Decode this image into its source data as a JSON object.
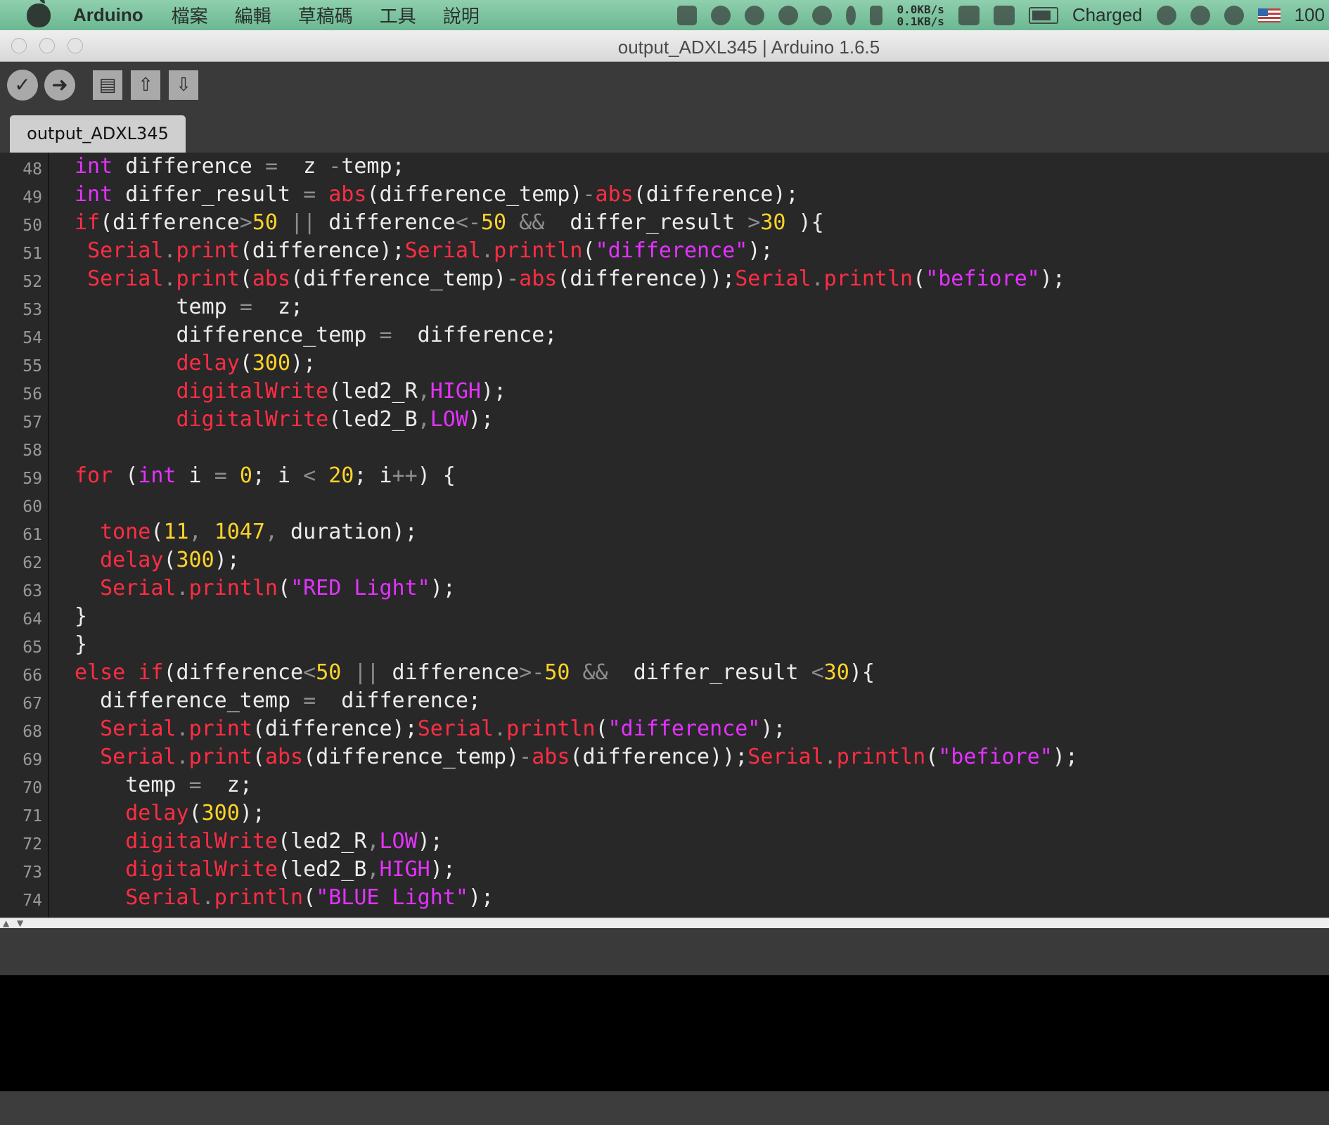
{
  "menubar": {
    "app_name": "Arduino",
    "menus": [
      "檔案",
      "編輯",
      "草稿碼",
      "工具",
      "說明"
    ],
    "net_up": "0.0KB/s",
    "net_down": "0.1KB/s",
    "battery_status": "Charged",
    "battery_percent": "100",
    "icons": [
      "apple-icon",
      "ji-icon",
      "line-icon",
      "creative-cloud-icon",
      "hat-icon",
      "check-shield-icon",
      "bluetooth-icon",
      "network-monitor-icon",
      "memory-icon",
      "disk-icon",
      "battery-icon",
      "time-machine-icon",
      "wifi-icon",
      "volume-icon",
      "flag-icon"
    ]
  },
  "window": {
    "title": "output_ADXL345 | Arduino 1.6.5"
  },
  "toolbar": {
    "buttons": [
      "verify",
      "upload",
      "new",
      "open",
      "save"
    ],
    "glyphs": [
      "✓",
      "➜",
      "▤",
      "⇧",
      "⇩"
    ]
  },
  "tabs": [
    {
      "label": "output_ADXL345"
    }
  ],
  "editor": {
    "line_numbers": [
      "48",
      "49",
      "50",
      "51",
      "52",
      "53",
      "54",
      "55",
      "56",
      "57",
      "58",
      "59",
      "60",
      "61",
      "62",
      "63",
      "64",
      "65",
      "66",
      "67",
      "68",
      "69",
      "70",
      "71",
      "72",
      "73",
      "74"
    ],
    "lines": [
      [
        [
          "k",
          "int"
        ],
        [
          "t",
          " difference "
        ],
        [
          "o",
          "="
        ],
        [
          "t",
          "  z "
        ],
        [
          "o",
          "-"
        ],
        [
          "t",
          "temp;"
        ]
      ],
      [
        [
          "k",
          "int"
        ],
        [
          "t",
          " differ_result "
        ],
        [
          "o",
          "="
        ],
        [
          "t",
          " "
        ],
        [
          "f",
          "abs"
        ],
        [
          "t",
          "(difference_temp)"
        ],
        [
          "o",
          "-"
        ],
        [
          "f",
          "abs"
        ],
        [
          "t",
          "(difference);"
        ]
      ],
      [
        [
          "f",
          "if"
        ],
        [
          "t",
          "(difference"
        ],
        [
          "o",
          ">"
        ],
        [
          "n",
          "50"
        ],
        [
          "t",
          " "
        ],
        [
          "o",
          "||"
        ],
        [
          "t",
          " difference"
        ],
        [
          "o",
          "<-"
        ],
        [
          "n",
          "50"
        ],
        [
          "t",
          " "
        ],
        [
          "o",
          "&&"
        ],
        [
          "t",
          "  differ_result "
        ],
        [
          "o",
          ">"
        ],
        [
          "n",
          "30"
        ],
        [
          "t",
          " ){"
        ]
      ],
      [
        [
          "t",
          " "
        ],
        [
          "f",
          "Serial"
        ],
        [
          "o",
          "."
        ],
        [
          "f",
          "print"
        ],
        [
          "t",
          "(difference);"
        ],
        [
          "f",
          "Serial"
        ],
        [
          "o",
          "."
        ],
        [
          "f",
          "println"
        ],
        [
          "t",
          "("
        ],
        [
          "s",
          "\"difference\""
        ],
        [
          "t",
          ");"
        ]
      ],
      [
        [
          "t",
          " "
        ],
        [
          "f",
          "Serial"
        ],
        [
          "o",
          "."
        ],
        [
          "f",
          "print"
        ],
        [
          "t",
          "("
        ],
        [
          "f",
          "abs"
        ],
        [
          "t",
          "(difference_temp)"
        ],
        [
          "o",
          "-"
        ],
        [
          "f",
          "abs"
        ],
        [
          "t",
          "(difference));"
        ],
        [
          "f",
          "Serial"
        ],
        [
          "o",
          "."
        ],
        [
          "f",
          "println"
        ],
        [
          "t",
          "("
        ],
        [
          "s",
          "\"befiore\""
        ],
        [
          "t",
          ");"
        ]
      ],
      [
        [
          "t",
          "        temp "
        ],
        [
          "o",
          "="
        ],
        [
          "t",
          "  z;"
        ]
      ],
      [
        [
          "t",
          "        difference_temp "
        ],
        [
          "o",
          "="
        ],
        [
          "t",
          "  difference;"
        ]
      ],
      [
        [
          "t",
          "        "
        ],
        [
          "f",
          "delay"
        ],
        [
          "t",
          "("
        ],
        [
          "n",
          "300"
        ],
        [
          "t",
          ");"
        ]
      ],
      [
        [
          "t",
          "        "
        ],
        [
          "f",
          "digitalWrite"
        ],
        [
          "t",
          "(led2_R"
        ],
        [
          "o",
          ","
        ],
        [
          "k",
          "HIGH"
        ],
        [
          "t",
          ");"
        ]
      ],
      [
        [
          "t",
          "        "
        ],
        [
          "f",
          "digitalWrite"
        ],
        [
          "t",
          "(led2_B"
        ],
        [
          "o",
          ","
        ],
        [
          "k",
          "LOW"
        ],
        [
          "t",
          ");"
        ]
      ],
      [],
      [
        [
          "f",
          "for"
        ],
        [
          "t",
          " ("
        ],
        [
          "k",
          "int"
        ],
        [
          "t",
          " i "
        ],
        [
          "o",
          "="
        ],
        [
          "t",
          " "
        ],
        [
          "n",
          "0"
        ],
        [
          "t",
          "; i "
        ],
        [
          "o",
          "<"
        ],
        [
          "t",
          " "
        ],
        [
          "n",
          "20"
        ],
        [
          "t",
          "; i"
        ],
        [
          "o",
          "++"
        ],
        [
          "t",
          ") {"
        ]
      ],
      [],
      [
        [
          "t",
          "  "
        ],
        [
          "f",
          "tone"
        ],
        [
          "t",
          "("
        ],
        [
          "n",
          "11"
        ],
        [
          "o",
          ","
        ],
        [
          "t",
          " "
        ],
        [
          "n",
          "1047"
        ],
        [
          "o",
          ","
        ],
        [
          "t",
          " duration);"
        ]
      ],
      [
        [
          "t",
          "  "
        ],
        [
          "f",
          "delay"
        ],
        [
          "t",
          "("
        ],
        [
          "n",
          "300"
        ],
        [
          "t",
          ");"
        ]
      ],
      [
        [
          "t",
          "  "
        ],
        [
          "f",
          "Serial"
        ],
        [
          "o",
          "."
        ],
        [
          "f",
          "println"
        ],
        [
          "t",
          "("
        ],
        [
          "s",
          "\"RED Light\""
        ],
        [
          "t",
          ");"
        ]
      ],
      [
        [
          "t",
          "}"
        ]
      ],
      [
        [
          "t",
          "}"
        ]
      ],
      [
        [
          "f",
          "else"
        ],
        [
          "t",
          " "
        ],
        [
          "f",
          "if"
        ],
        [
          "t",
          "(difference"
        ],
        [
          "o",
          "<"
        ],
        [
          "n",
          "50"
        ],
        [
          "t",
          " "
        ],
        [
          "o",
          "||"
        ],
        [
          "t",
          " difference"
        ],
        [
          "o",
          ">-"
        ],
        [
          "n",
          "50"
        ],
        [
          "t",
          " "
        ],
        [
          "o",
          "&&"
        ],
        [
          "t",
          "  differ_result "
        ],
        [
          "o",
          "<"
        ],
        [
          "n",
          "30"
        ],
        [
          "t",
          "){"
        ]
      ],
      [
        [
          "t",
          "  difference_temp "
        ],
        [
          "o",
          "="
        ],
        [
          "t",
          "  difference;"
        ]
      ],
      [
        [
          "t",
          "  "
        ],
        [
          "f",
          "Serial"
        ],
        [
          "o",
          "."
        ],
        [
          "f",
          "print"
        ],
        [
          "t",
          "(difference);"
        ],
        [
          "f",
          "Serial"
        ],
        [
          "o",
          "."
        ],
        [
          "f",
          "println"
        ],
        [
          "t",
          "("
        ],
        [
          "s",
          "\"difference\""
        ],
        [
          "t",
          ");"
        ]
      ],
      [
        [
          "t",
          "  "
        ],
        [
          "f",
          "Serial"
        ],
        [
          "o",
          "."
        ],
        [
          "f",
          "print"
        ],
        [
          "t",
          "("
        ],
        [
          "f",
          "abs"
        ],
        [
          "t",
          "(difference_temp)"
        ],
        [
          "o",
          "-"
        ],
        [
          "f",
          "abs"
        ],
        [
          "t",
          "(difference));"
        ],
        [
          "f",
          "Serial"
        ],
        [
          "o",
          "."
        ],
        [
          "f",
          "println"
        ],
        [
          "t",
          "("
        ],
        [
          "s",
          "\"befiore\""
        ],
        [
          "t",
          ");"
        ]
      ],
      [
        [
          "t",
          "    temp "
        ],
        [
          "o",
          "="
        ],
        [
          "t",
          "  z;"
        ]
      ],
      [
        [
          "t",
          "    "
        ],
        [
          "f",
          "delay"
        ],
        [
          "t",
          "("
        ],
        [
          "n",
          "300"
        ],
        [
          "t",
          ");"
        ]
      ],
      [
        [
          "t",
          "    "
        ],
        [
          "f",
          "digitalWrite"
        ],
        [
          "t",
          "(led2_R"
        ],
        [
          "o",
          ","
        ],
        [
          "k",
          "LOW"
        ],
        [
          "t",
          ");"
        ]
      ],
      [
        [
          "t",
          "    "
        ],
        [
          "f",
          "digitalWrite"
        ],
        [
          "t",
          "(led2_B"
        ],
        [
          "o",
          ","
        ],
        [
          "k",
          "HIGH"
        ],
        [
          "t",
          ");"
        ]
      ],
      [
        [
          "t",
          "    "
        ],
        [
          "f",
          "Serial"
        ],
        [
          "o",
          "."
        ],
        [
          "f",
          "println"
        ],
        [
          "t",
          "("
        ],
        [
          "s",
          "\"BLUE Light\""
        ],
        [
          "t",
          ");"
        ]
      ]
    ]
  },
  "colors": {
    "keyword": "#e432ff",
    "function": "#ff2d43",
    "number": "#ffd428",
    "string": "#e432ff",
    "operator": "#8e8e8e",
    "text": "#ececec",
    "editor_bg": "#282828"
  }
}
